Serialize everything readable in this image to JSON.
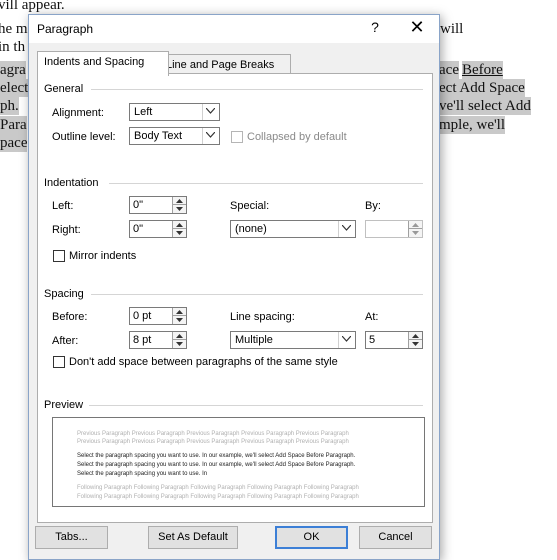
{
  "document": {
    "lines": [
      {
        "text": "vill appear.",
        "highlight": false
      },
      {
        "text": "he m",
        "highlight": false
      },
      {
        "text": " will",
        "highlight": false
      },
      {
        "text": "in th",
        "highlight": false
      },
      {
        "text": "agra",
        "highlight": true
      },
      {
        "text": "ace ",
        "highlight": true
      },
      {
        "text": "Before",
        "highlight": true
      },
      {
        "text": "elect",
        "highlight": true
      },
      {
        "text": "ect Add Space",
        "highlight": true
      },
      {
        "text": "ph.",
        "highlight": true
      },
      {
        "text": "ve'll select Add",
        "highlight": true
      },
      {
        "text": " Para",
        "highlight": true
      },
      {
        "text": "mple, we'll",
        "highlight": true
      },
      {
        "text": "pace",
        "highlight": true
      }
    ]
  },
  "dialog": {
    "title": "Paragraph",
    "help": "?",
    "close": "✕",
    "tabs": [
      {
        "label": "Indents and Spacing",
        "active": true
      },
      {
        "label": "Line and Page Breaks",
        "active": false
      }
    ],
    "general": {
      "heading": "General",
      "alignment_label": "Alignment:",
      "alignment_value": "Left",
      "outline_label": "Outline level:",
      "outline_value": "Body Text",
      "collapsed_label": "Collapsed by default"
    },
    "indentation": {
      "heading": "Indentation",
      "left_label": "Left:",
      "left_value": "0\"",
      "right_label": "Right:",
      "right_value": "0\"",
      "special_label": "Special:",
      "special_value": "(none)",
      "by_label": "By:",
      "by_value": "",
      "mirror_label": "Mirror indents"
    },
    "spacing": {
      "heading": "Spacing",
      "before_label": "Before:",
      "before_value": "0 pt",
      "after_label": "After:",
      "after_value": "8 pt",
      "line_spacing_label": "Line spacing:",
      "line_spacing_value": "Multiple",
      "at_label": "At:",
      "at_value": "5",
      "dont_add_label": "Don't add space between paragraphs of the same style"
    },
    "preview": {
      "heading": "Preview",
      "previous": [
        "Previous Paragraph Previous Paragraph Previous Paragraph Previous Paragraph Previous Paragraph",
        "Previous Paragraph Previous Paragraph Previous Paragraph Previous Paragraph Previous Paragraph"
      ],
      "current": [
        "Select the paragraph spacing you want to use. In our example, we'll select Add Space Before Paragraph.",
        "Select the paragraph spacing you want to use. In our example, we'll select Add Space Before Paragraph.",
        "Select the paragraph spacing you want to use. In"
      ],
      "following": [
        "Following Paragraph Following Paragraph Following Paragraph Following Paragraph Following Paragraph",
        "Following Paragraph Following Paragraph Following Paragraph Following Paragraph Following Paragraph"
      ]
    },
    "buttons": {
      "tabs": "Tabs...",
      "set_default": "Set As Default",
      "ok": "OK",
      "cancel": "Cancel"
    }
  }
}
